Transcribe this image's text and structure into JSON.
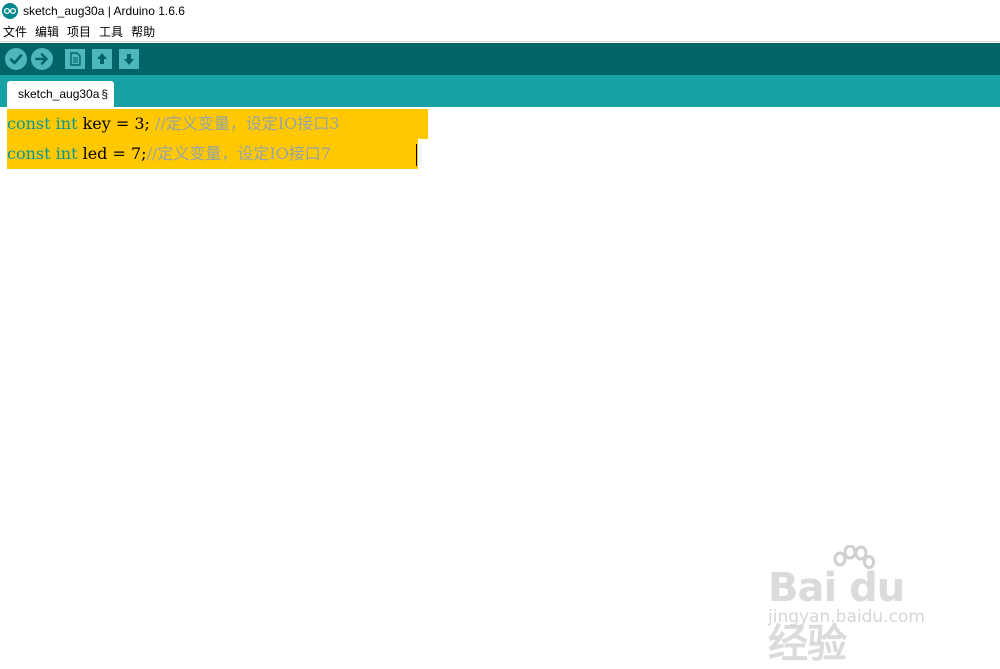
{
  "window": {
    "title": "sketch_aug30a | Arduino 1.6.6"
  },
  "menubar": {
    "items": [
      "文件",
      "编辑",
      "项目",
      "工具",
      "帮助"
    ]
  },
  "toolbar": {
    "buttons": [
      {
        "name": "verify",
        "icon": "check-icon"
      },
      {
        "name": "upload",
        "icon": "arrow-right-icon"
      },
      {
        "name": "new",
        "icon": "new-file-icon"
      },
      {
        "name": "open",
        "icon": "arrow-up-icon"
      },
      {
        "name": "save",
        "icon": "arrow-down-icon"
      }
    ]
  },
  "tabs": [
    {
      "label": "sketch_aug30a",
      "modified_marker": "§"
    }
  ],
  "editor": {
    "lines": [
      {
        "kw1": "const",
        "kw2": "int",
        "code": " key = 3; ",
        "comment": "//定义变量，设定IO接口3"
      },
      {
        "kw1": "const",
        "kw2": "int",
        "code": " led = 7;",
        "comment": "//定义变量，设定IO接口7"
      }
    ],
    "selection_color": "#ffc800",
    "keyword_color": "#00979c"
  },
  "watermark": {
    "brand": "Bai du 经验",
    "url": "jingyan.baidu.com"
  },
  "colors": {
    "toolbar": "#006468",
    "tabbar": "#17a1a5",
    "button": "#4db7bb"
  }
}
